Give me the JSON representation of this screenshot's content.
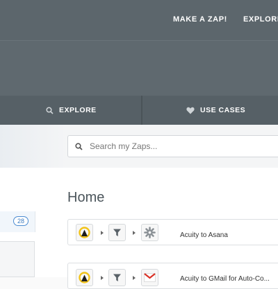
{
  "topnav": {
    "make_zap": "MAKE A ZAP!",
    "explore": "EXPLORE"
  },
  "subnav": {
    "explore": "EXPLORE",
    "use_cases": "USE CASES"
  },
  "search": {
    "placeholder": "Search my Zaps..."
  },
  "page": {
    "title": "Home"
  },
  "sidebar": {
    "zap_count": "28"
  },
  "zaps": [
    {
      "title": "Acuity to Asana",
      "steps": [
        "acuity-logo-icon",
        "filter-icon",
        "gear-icon"
      ]
    },
    {
      "title": "Acuity to GMail for Auto-Co...",
      "steps": [
        "acuity-logo-icon",
        "filter-icon",
        "gmail-icon"
      ]
    }
  ],
  "colors": {
    "header": "#5c666c",
    "subnav": "#566066",
    "badge": "#4a8bd1"
  }
}
